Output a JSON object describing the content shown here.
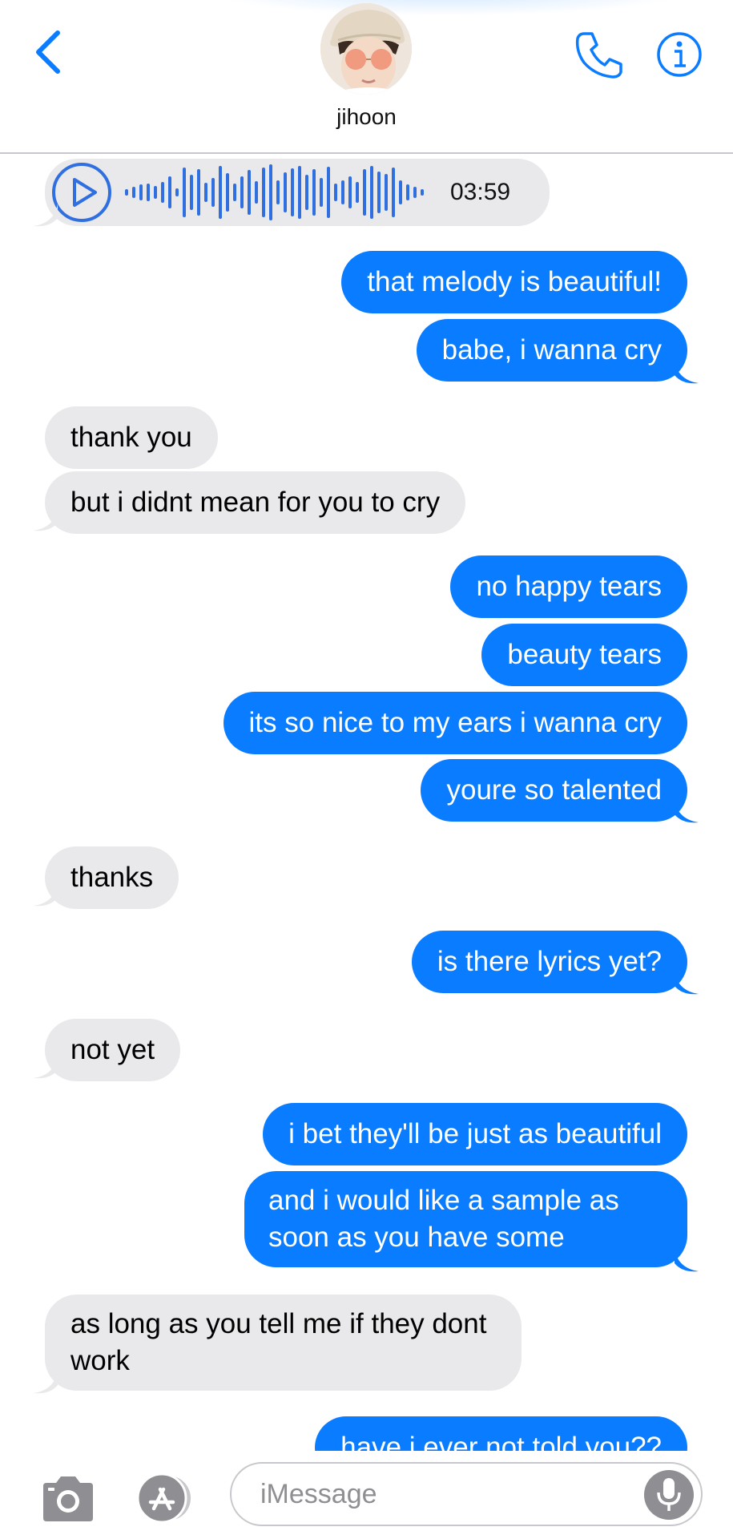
{
  "header": {
    "contact_name": "jihoon",
    "back_icon": "chevron-left-icon",
    "call_icon": "phone-icon",
    "info_icon": "info-icon",
    "accent_color": "#0a7cff"
  },
  "voice_message": {
    "duration": "03:59",
    "play_icon": "play-icon"
  },
  "messages": [
    {
      "sender": "me",
      "text": "that melody is beautiful!"
    },
    {
      "sender": "me",
      "text": "babe, i wanna cry"
    },
    {
      "sender": "contact",
      "text": "thank you"
    },
    {
      "sender": "contact",
      "text": "but i didnt mean for you to cry"
    },
    {
      "sender": "me",
      "text": "no happy tears"
    },
    {
      "sender": "me",
      "text": "beauty tears"
    },
    {
      "sender": "me",
      "text": "its so nice to my ears i wanna cry"
    },
    {
      "sender": "me",
      "text": "youre so talented"
    },
    {
      "sender": "contact",
      "text": "thanks"
    },
    {
      "sender": "me",
      "text": "is there lyrics yet?"
    },
    {
      "sender": "contact",
      "text": "not yet"
    },
    {
      "sender": "me",
      "text": "i bet they'll be just as beautiful"
    },
    {
      "sender": "me",
      "text": "and i would like a sample as soon as you have some"
    },
    {
      "sender": "contact",
      "text": "as long as you tell me if they dont work"
    },
    {
      "sender": "me",
      "text": "have i ever not told you??"
    }
  ],
  "input_bar": {
    "placeholder": "iMessage",
    "camera_icon": "camera-icon",
    "apps_icon": "app-store-icon",
    "mic_icon": "microphone-icon"
  },
  "colors": {
    "outgoing_bubble": "#0a7cff",
    "incoming_bubble": "#e9e9eb"
  }
}
